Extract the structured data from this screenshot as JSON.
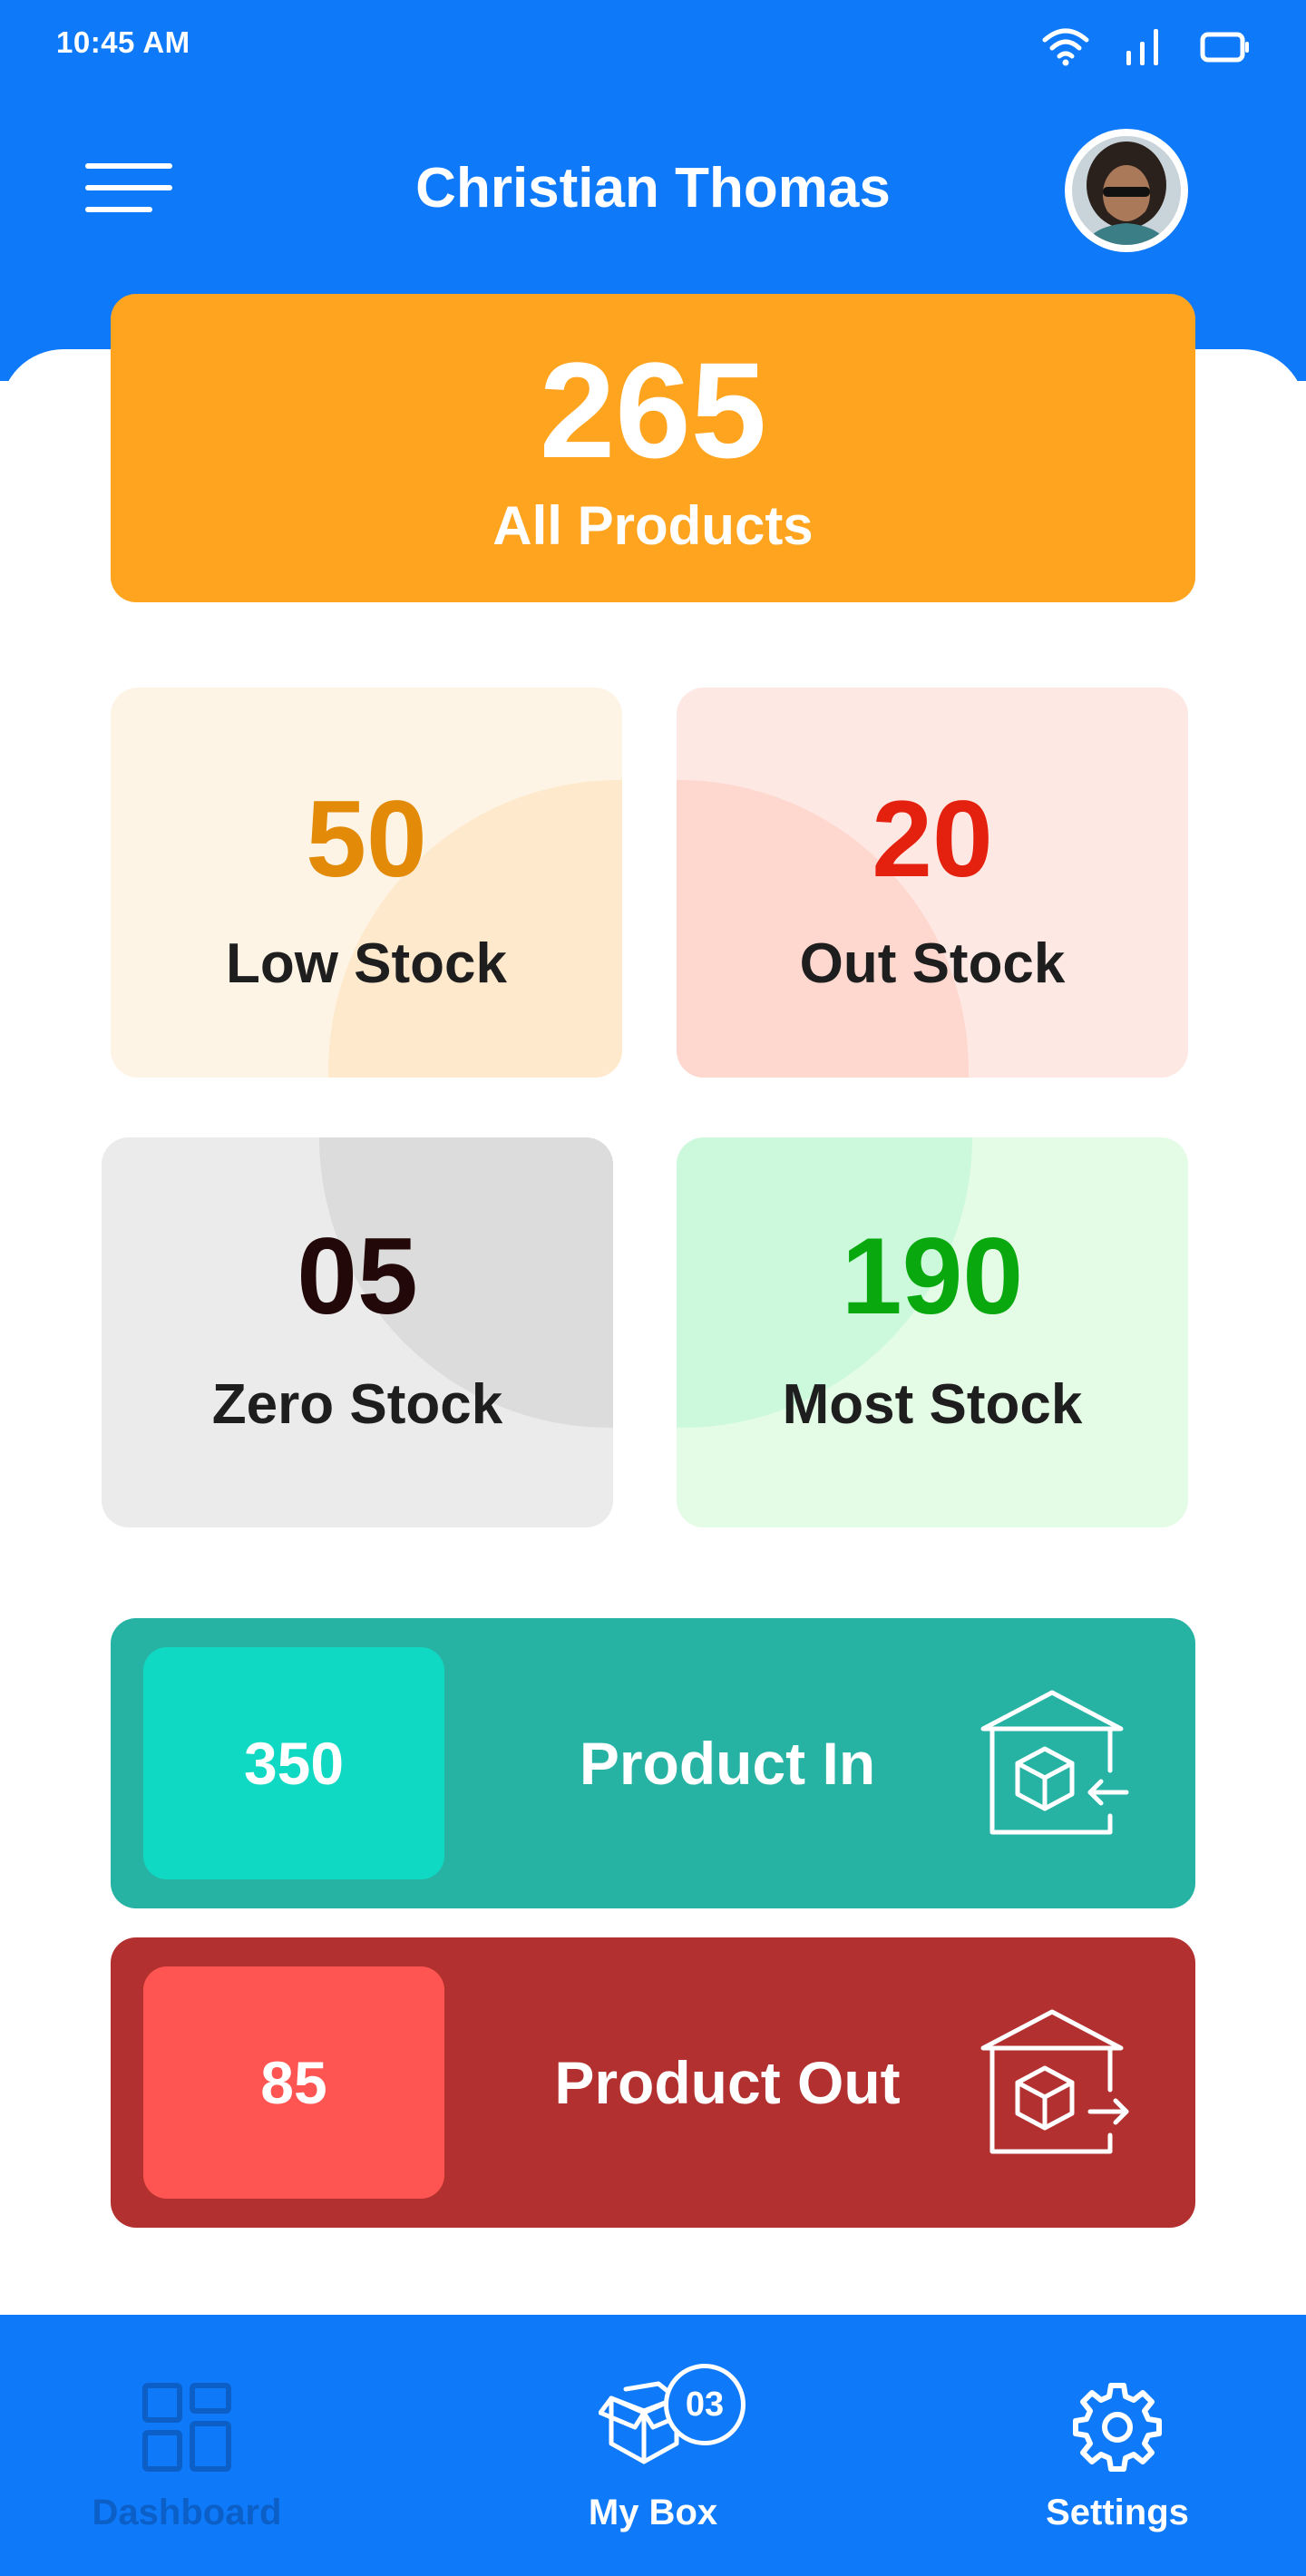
{
  "status_bar": {
    "time": "10:45 AM",
    "icons": [
      "wifi-icon",
      "signal-icon",
      "battery-icon"
    ]
  },
  "header": {
    "title": "Christian Thomas",
    "menu_icon": "hamburger-menu-icon",
    "avatar_icon": "avatar"
  },
  "summary": {
    "all_products_count": "265",
    "all_products_label": "All Products"
  },
  "tiles": [
    {
      "value": "50",
      "label": "Low Stock",
      "accent": "#E38B08",
      "bg": "#FEF4E6"
    },
    {
      "value": "20",
      "label": "Out Stock",
      "accent": "#E4200E",
      "bg": "#FEE8E4"
    },
    {
      "value": "05",
      "label": "Zero Stock",
      "accent": "#23080A",
      "bg": "#EBEBEB"
    },
    {
      "value": "190",
      "label": "Most Stock",
      "accent": "#08A80E",
      "bg": "#E4FCE6"
    }
  ],
  "flows": [
    {
      "count": "350",
      "label": "Product In",
      "icon": "warehouse-in-icon",
      "bar_color": "#27B3A4",
      "count_color": "#0FD9C3"
    },
    {
      "count": "85",
      "label": "Product Out",
      "icon": "warehouse-out-icon",
      "bar_color": "#B33030",
      "count_color": "#FF5552"
    }
  ],
  "bottom_nav": {
    "items": [
      {
        "label": "Dashboard",
        "icon": "dashboard-grid-icon",
        "active": false
      },
      {
        "label": "My Box",
        "icon": "box-icon",
        "badge": "03",
        "active": true
      },
      {
        "label": "Settings",
        "icon": "gear-icon",
        "active": true
      }
    ]
  },
  "colors": {
    "primary": "#0E7AF9",
    "all_products": "#FFA41F"
  }
}
